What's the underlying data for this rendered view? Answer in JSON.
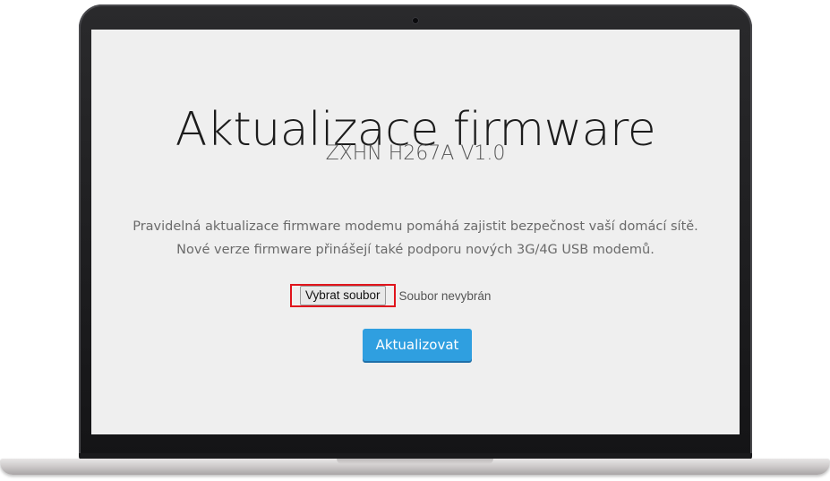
{
  "page": {
    "title": "Aktualizace firmware",
    "model": "ZXHN H267A V1.0",
    "description_line1": "Pravidelná aktualizace firmware modemu pomáhá zajistit bezpečnost vaší domácí sítě.",
    "description_line2": "Nové verze firmware přinášejí také podporu nových 3G/4G USB modemů."
  },
  "file_input": {
    "button_label": "Vybrat soubor",
    "status_text": "Soubor nevybrán",
    "highlight_color": "#e0141c"
  },
  "update_button": {
    "label": "Aktualizovat",
    "color": "#2f9fe0"
  }
}
